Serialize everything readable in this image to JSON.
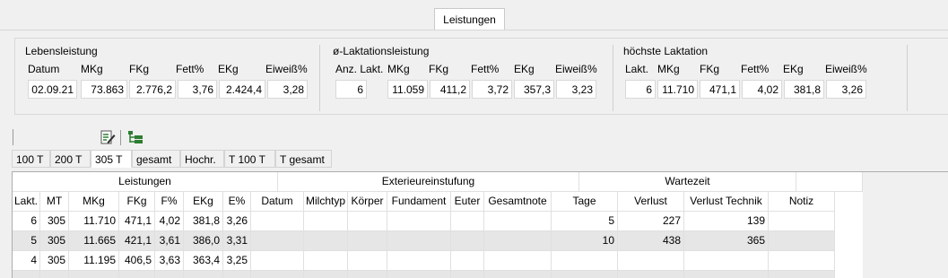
{
  "tab": "Leistungen",
  "lebensleistung": {
    "title": "Lebensleistung",
    "headers": [
      "Datum",
      "MKg",
      "FKg",
      "Fett%",
      "EKg",
      "Eiweiß%"
    ],
    "values": [
      "02.09.21",
      "73.863",
      "2.776,2",
      "3,76",
      "2.424,4",
      "3,28"
    ]
  },
  "laktationsleistung": {
    "title": "ø-Laktationsleistung",
    "headers": [
      "Anz. Lakt.",
      "MKg",
      "FKg",
      "Fett%",
      "EKg",
      "Eiweiß%"
    ],
    "values": [
      "6",
      "11.059",
      "411,2",
      "3,72",
      "357,3",
      "3,23"
    ]
  },
  "hoechste": {
    "title": "höchste Laktation",
    "headers": [
      "Lakt.",
      "MKg",
      "FKg",
      "Fett%",
      "EKg",
      "Eiweiß%"
    ],
    "values": [
      "6",
      "11.710",
      "471,1",
      "4,02",
      "381,8",
      "3,26"
    ]
  },
  "subtabs": [
    "100 T",
    "200 T",
    "305 T",
    "gesamt",
    "Hochr.",
    "T 100 T",
    "T gesamt"
  ],
  "active_subtab": "305 T",
  "grid": {
    "group_headers": [
      "Leistungen",
      "Exterieureinstufung",
      "Wartezeit"
    ],
    "columns": [
      "Lakt.",
      "MT",
      "MKg",
      "FKg",
      "F%",
      "EKg",
      "E%",
      "Datum",
      "Milchtyp",
      "Körper",
      "Fundament",
      "Euter",
      "Gesamtnote",
      "Tage",
      "Verlust",
      "Verlust Technik",
      "Notiz"
    ],
    "rows": [
      [
        "6",
        "305",
        "11.710",
        "471,1",
        "4,02",
        "381,8",
        "3,26",
        "",
        "",
        "",
        "",
        "",
        "",
        "5",
        "227",
        "139",
        ""
      ],
      [
        "5",
        "305",
        "11.665",
        "421,1",
        "3,61",
        "386,0",
        "3,31",
        "",
        "",
        "",
        "",
        "",
        "",
        "10",
        "438",
        "365",
        ""
      ],
      [
        "4",
        "305",
        "11.195",
        "406,5",
        "3,63",
        "363,4",
        "3,25",
        "",
        "",
        "",
        "",
        "",
        "",
        "",
        "",
        "",
        ""
      ]
    ]
  },
  "icons": [
    "edit-list-icon",
    "tree-list-icon"
  ]
}
